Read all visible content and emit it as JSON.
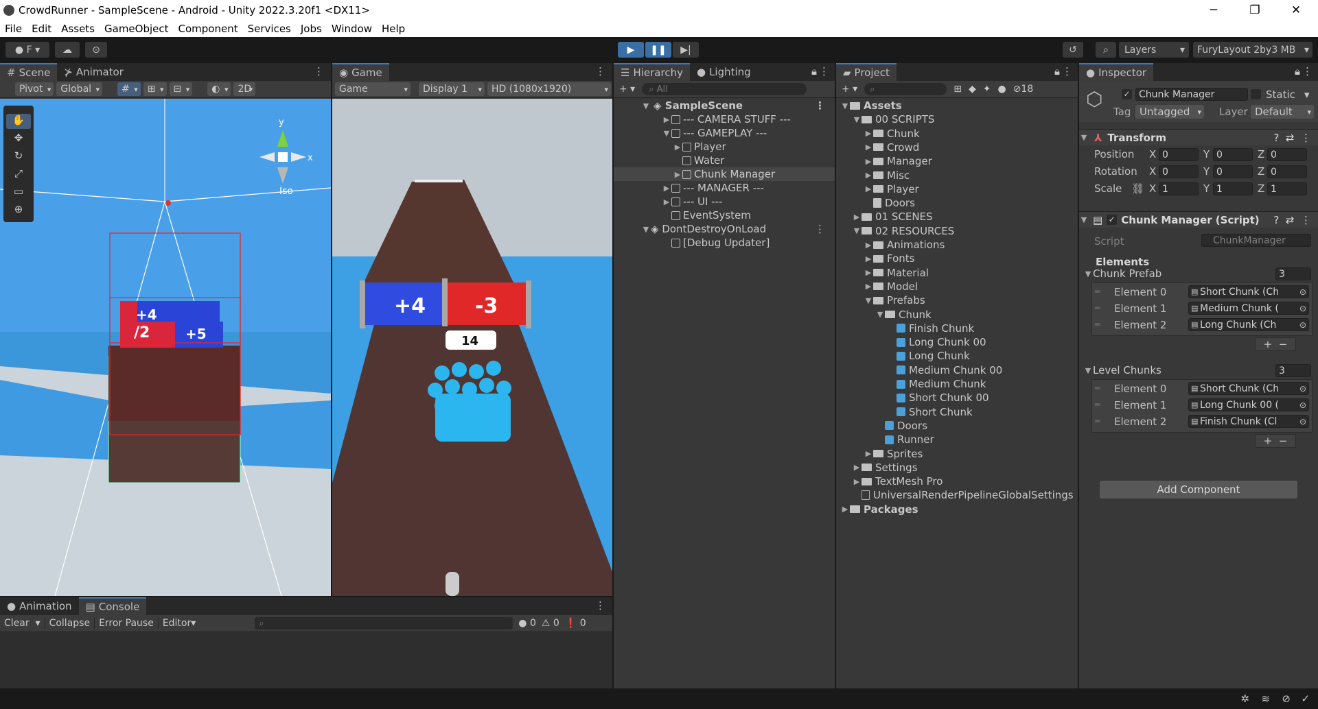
{
  "window": {
    "title": "CrowdRunner - SampleScene - Android - Unity 2022.3.20f1 <DX11>",
    "min": "─",
    "max": "❐",
    "close": "✕"
  },
  "menu": [
    "File",
    "Edit",
    "Assets",
    "GameObject",
    "Component",
    "Services",
    "Jobs",
    "Window",
    "Help"
  ],
  "toolbar": {
    "account": "F",
    "layers": "Layers",
    "layout": "FuryLayout 2by3 MB"
  },
  "scene": {
    "tab": "Scene",
    "tab2": "Animator",
    "pivot": "Pivot",
    "global": "Global",
    "mode2d": "2D",
    "iso": "Iso",
    "gizmo_y": "y",
    "gizmo_x": "x"
  },
  "game": {
    "tab": "Game",
    "view": "Game",
    "display": "Display 1",
    "resolution": "HD (1080x1920)",
    "gate_left": "+4",
    "gate_right": "-3",
    "count": "14",
    "scene_gate_a": "+4",
    "scene_gate_b": "/2",
    "scene_gate_c": "+5"
  },
  "hierarchy": {
    "tab": "Hierarchy",
    "tab2": "Lighting",
    "search": "All",
    "items": [
      {
        "label": "SampleScene",
        "bold": true
      },
      {
        "label": "--- CAMERA STUFF ---"
      },
      {
        "label": "--- GAMEPLAY ---"
      },
      {
        "label": "Player"
      },
      {
        "label": "Water"
      },
      {
        "label": "Chunk Manager"
      },
      {
        "label": "--- MANAGER ---"
      },
      {
        "label": "--- UI ---"
      },
      {
        "label": "EventSystem"
      },
      {
        "label": "DontDestroyOnLoad"
      },
      {
        "label": "[Debug Updater]"
      }
    ]
  },
  "project": {
    "tab": "Project",
    "hidden_count": "18",
    "items": [
      "Assets",
      "00 SCRIPTS",
      "Chunk",
      "Crowd",
      "Manager",
      "Misc",
      "Player",
      "Doors",
      "01 SCENES",
      "02 RESOURCES",
      "Animations",
      "Fonts",
      "Material",
      "Model",
      "Prefabs",
      "Chunk",
      "Finish Chunk",
      "Long Chunk 00",
      "Long Chunk",
      "Medium Chunk 00",
      "Medium Chunk",
      "Short Chunk 00",
      "Short Chunk",
      "Doors",
      "Runner",
      "Sprites",
      "Settings",
      "TextMesh Pro",
      "UniversalRenderPipelineGlobalSettings",
      "Packages"
    ]
  },
  "inspector": {
    "tab": "Inspector",
    "name": "Chunk Manager",
    "static": "Static",
    "tag_label": "Tag",
    "tag": "Untagged",
    "layer_label": "Layer",
    "layer": "Default",
    "transform": "Transform",
    "position": "Position",
    "rotation": "Rotation",
    "scale": "Scale",
    "x": "X",
    "y": "Y",
    "z": "Z",
    "pos": [
      "0",
      "0",
      "0"
    ],
    "rot": [
      "0",
      "0",
      "0"
    ],
    "scl": [
      "1",
      "1",
      "1"
    ],
    "script_comp": "Chunk Manager (Script)",
    "script_label": "Script",
    "script_value": "ChunkManager",
    "elements": "Elements",
    "chunk_prefab": "Chunk Prefab",
    "chunk_prefab_count": "3",
    "chunk_items": [
      {
        "label": "Element 0",
        "value": "Short Chunk (Ch"
      },
      {
        "label": "Element 1",
        "value": "Medium Chunk ("
      },
      {
        "label": "Element 2",
        "value": "Long Chunk (Ch"
      }
    ],
    "level_chunks": "Level Chunks",
    "level_chunks_count": "3",
    "level_items": [
      {
        "label": "Element 0",
        "value": "Short Chunk (Ch"
      },
      {
        "label": "Element 1",
        "value": "Long Chunk 00 ("
      },
      {
        "label": "Element 2",
        "value": "Finish Chunk (Cl"
      }
    ],
    "add_component": "Add Component"
  },
  "console": {
    "tab": "Animation",
    "tab2": "Console",
    "clear": "Clear",
    "collapse": "Collapse",
    "error_pause": "Error Pause",
    "editor": "Editor",
    "log_count": "0",
    "warn_count": "0",
    "err_count": "0"
  }
}
